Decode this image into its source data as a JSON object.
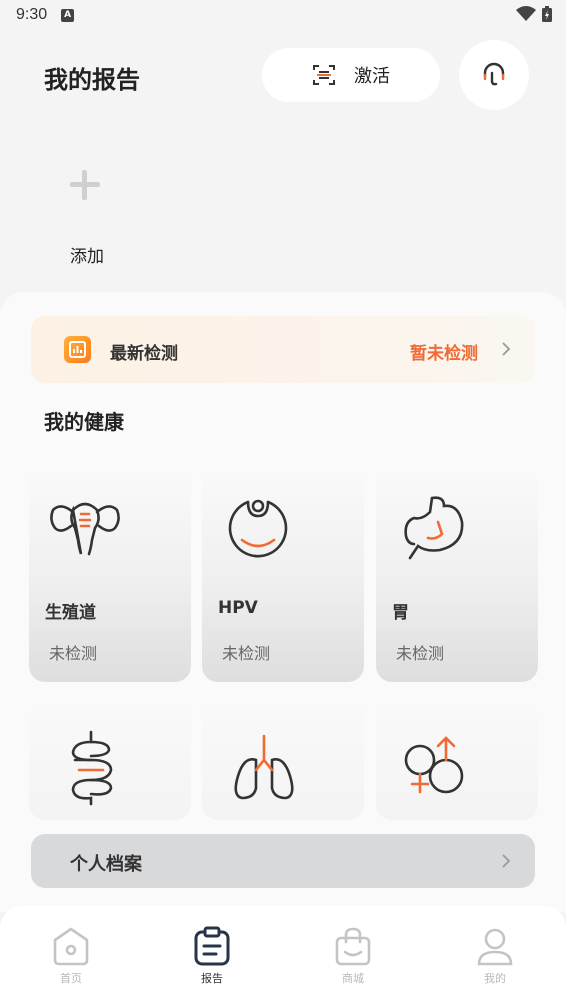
{
  "status": {
    "time": "9:30"
  },
  "header": {
    "title": "我的报告",
    "activate_label": "激活"
  },
  "add": {
    "label": "添加"
  },
  "latest": {
    "label": "最新检测",
    "status": "暂未检测"
  },
  "health": {
    "title": "我的健康",
    "tiles": [
      {
        "name": "生殖道",
        "status": "未检测"
      },
      {
        "name": "HPV",
        "status": "未检测"
      },
      {
        "name": "胃",
        "status": "未检测"
      }
    ]
  },
  "profile": {
    "label": "个人档案"
  },
  "tabbar": {
    "tabs": [
      {
        "label": "首页",
        "icon": "home-icon"
      },
      {
        "label": "报告",
        "icon": "report-icon"
      },
      {
        "label": "商城",
        "icon": "shop-bag-icon"
      },
      {
        "label": "我的",
        "icon": "user-icon"
      }
    ]
  },
  "colors": {
    "accent": "#ef6a34",
    "icon_dark": "#333333",
    "tab_active": "#27344a",
    "tab_inactive": "#c4c4c4"
  }
}
